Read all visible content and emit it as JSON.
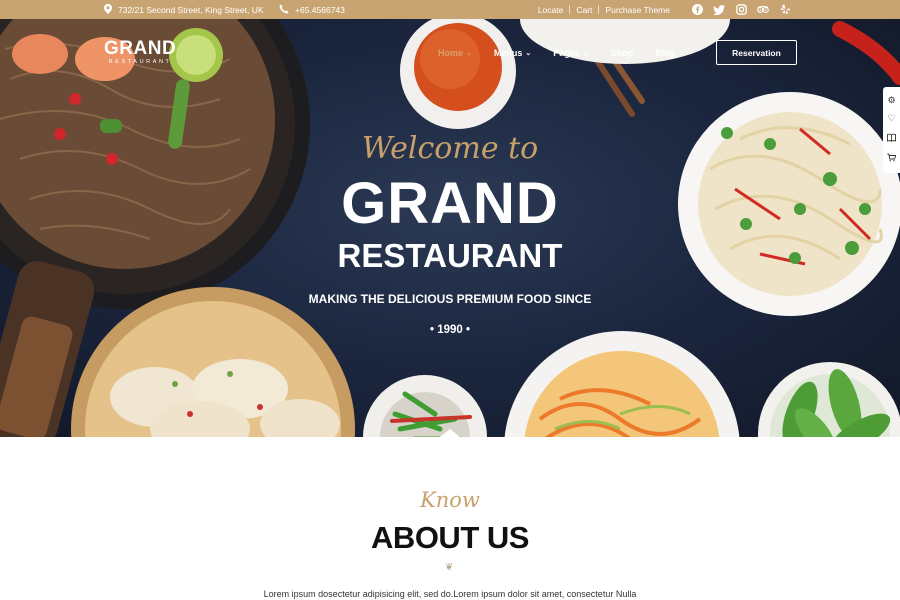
{
  "topbar": {
    "address": "732/21 Second Street, King Street, UK",
    "phone": "+65.4566743",
    "links": [
      "Locate",
      "Cart",
      "Purchase Theme"
    ],
    "social_icons": [
      "facebook-icon",
      "twitter-icon",
      "instagram-icon",
      "tripadvisor-icon",
      "yelp-icon"
    ]
  },
  "logo": {
    "main": "GRAND",
    "sub": "RESTAURANT"
  },
  "nav": {
    "items": [
      {
        "label": "Home",
        "dropdown": true,
        "active": true
      },
      {
        "label": "Menus",
        "dropdown": true,
        "active": false
      },
      {
        "label": "Pages",
        "dropdown": true,
        "active": false
      },
      {
        "label": "Shop",
        "dropdown": false,
        "active": false
      },
      {
        "label": "Blog",
        "dropdown": true,
        "active": false
      }
    ],
    "reservation_label": "Reservation"
  },
  "side_tools": [
    "settings-icon",
    "heart-icon",
    "book-icon",
    "cart-icon"
  ],
  "hero": {
    "welcome": "Welcome to",
    "title_line1": "GRAND",
    "title_line2": "RESTAURANT",
    "tagline": "MAKING THE DELICIOUS PREMIUM FOOD SINCE",
    "since": "• 1990 •"
  },
  "about": {
    "kicker": "Know",
    "title": "ABOUT US",
    "text": "Lorem ipsum dosectetur adipisicing elit, sed do.Lorem ipsum dolor sit amet, consectetur Nulla"
  },
  "colors": {
    "accent": "#c8a472",
    "accent_text": "#d9a268",
    "hero_bg": "#1c2740",
    "white": "#ffffff"
  }
}
